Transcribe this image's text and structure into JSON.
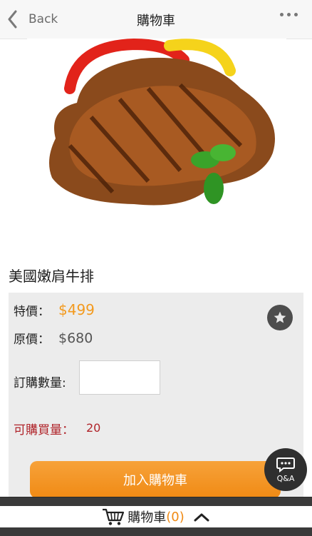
{
  "nav": {
    "back_label": "Back",
    "title": "購物車"
  },
  "product": {
    "name": "美國嫩肩牛排",
    "special_label": "特價：",
    "special_price": "$499",
    "original_label": "原價：",
    "original_price": "$680",
    "qty_label": "訂購數量:",
    "qty_value": "",
    "avail_label": "可購買量：",
    "avail_value": "20",
    "add_to_cart": "加入購物車"
  },
  "qa": {
    "label": "Q&A"
  },
  "cart": {
    "label": "購物車",
    "open_paren": "(",
    "count": "0",
    "close_paren": ")"
  },
  "colors": {
    "accent": "#f08a14",
    "price": "#f39a1e",
    "avail": "#b0242a",
    "bottombar": "#3a3a3a"
  }
}
